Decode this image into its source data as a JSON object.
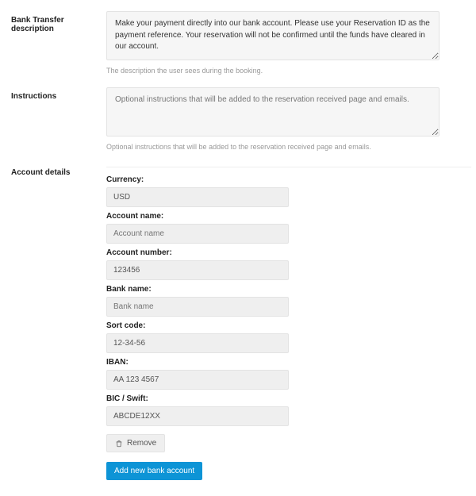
{
  "fields": {
    "description": {
      "label": "Bank Transfer description",
      "value": "Make your payment directly into our bank account. Please use your Reservation ID as the payment reference. Your reservation will not be confirmed until the funds have cleared in our account.",
      "hint": "The description the user sees during the booking."
    },
    "instructions": {
      "label": "Instructions",
      "value": "",
      "placeholder": "Optional instructions that will be added to the reservation received page and emails.",
      "hint": "Optional instructions that will be added to the reservation received page and emails."
    },
    "account_details": {
      "label": "Account details"
    }
  },
  "account": {
    "currency": {
      "label": "Currency:",
      "value": "USD"
    },
    "account_name": {
      "label": "Account name:",
      "value": "",
      "placeholder": "Account name"
    },
    "account_number": {
      "label": "Account number:",
      "value": "123456"
    },
    "bank_name": {
      "label": "Bank name:",
      "value": "",
      "placeholder": "Bank name"
    },
    "sort_code": {
      "label": "Sort code:",
      "value": "12-34-56"
    },
    "iban": {
      "label": "IBAN:",
      "value": "AA 123 4567"
    },
    "bic_swift": {
      "label": "BIC / Swift:",
      "value": "ABCDE12XX"
    }
  },
  "buttons": {
    "remove": "Remove",
    "add": "Add new bank account"
  }
}
